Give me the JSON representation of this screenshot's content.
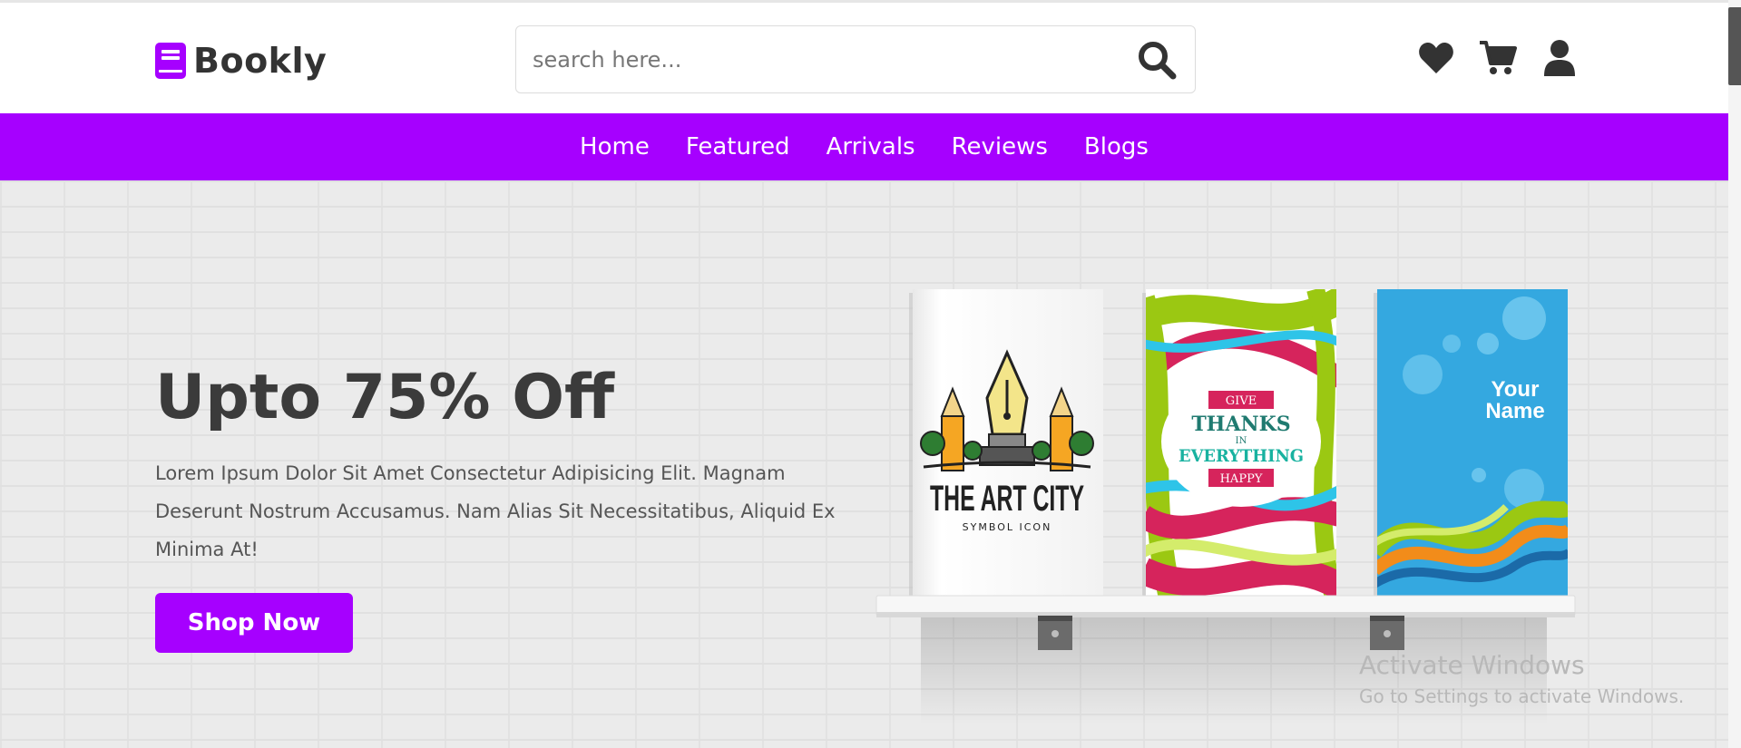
{
  "brand": {
    "name": "Bookly",
    "color": "#a600ff"
  },
  "search": {
    "placeholder": "search here...",
    "icon": "search-icon"
  },
  "header_icons": [
    "heart-icon",
    "cart-icon",
    "user-icon"
  ],
  "nav": {
    "items": [
      {
        "label": "Home"
      },
      {
        "label": "Featured"
      },
      {
        "label": "Arrivals"
      },
      {
        "label": "Reviews"
      },
      {
        "label": "Blogs"
      }
    ]
  },
  "hero": {
    "title": "Upto 75% Off",
    "text": "Lorem Ipsum Dolor Sit Amet Consectetur Adipisicing Elit. Magnam Deserunt Nostrum Accusamus. Nam Alias Sit Necessitatibus, Aliquid Ex Minima At!",
    "button": "Shop Now"
  },
  "books": [
    {
      "title": "THE ART CITY",
      "subtitle": "SYMBOL ICON"
    },
    {
      "lines": [
        "GIVE",
        "THANKS",
        "IN",
        "EVERYTHING",
        "HAPPY"
      ]
    },
    {
      "lines": [
        "Your",
        "Name"
      ]
    }
  ],
  "watermark": {
    "title": "Activate Windows",
    "subtitle": "Go to Settings to activate Windows."
  },
  "colors": {
    "accent": "#a600ff",
    "text_dark": "#3b3b3b",
    "text_body": "#555555"
  }
}
